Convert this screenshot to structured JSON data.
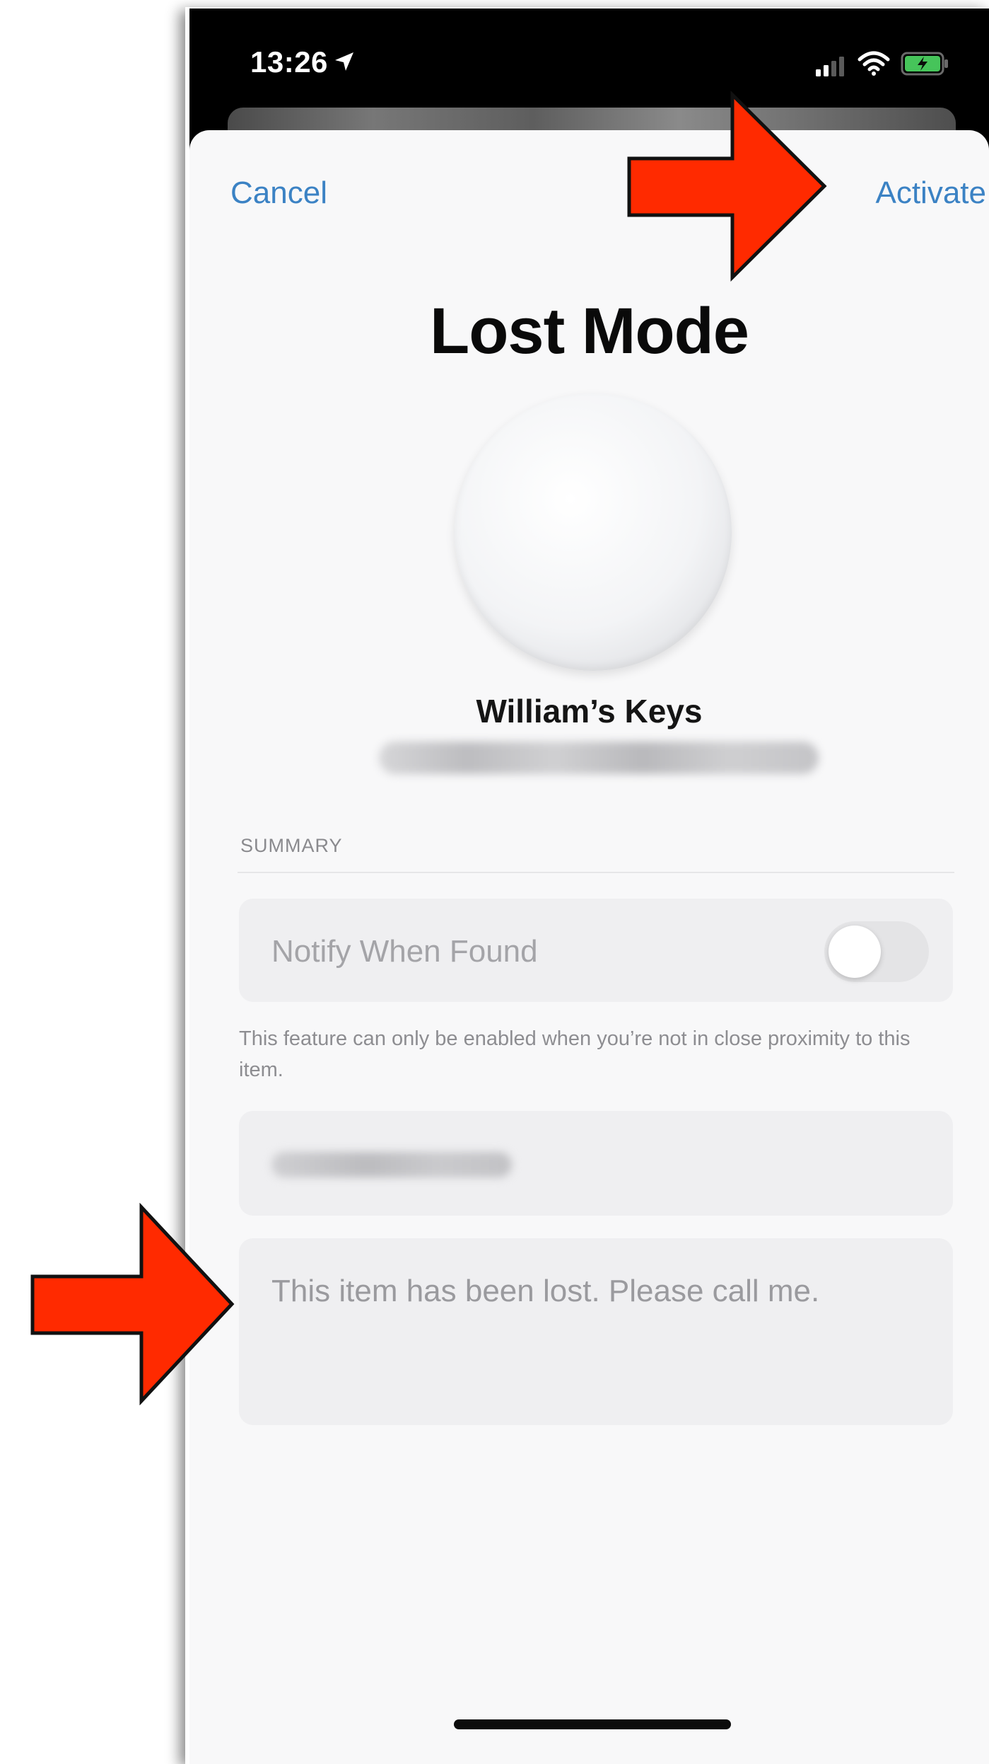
{
  "status_bar": {
    "time": "13:26",
    "icons": [
      "location-arrow-icon",
      "cellular-signal-icon",
      "wifi-icon",
      "battery-charging-icon"
    ]
  },
  "nav": {
    "cancel_label": "Cancel",
    "activate_label": "Activate"
  },
  "page": {
    "title": "Lost Mode"
  },
  "item": {
    "name": "William’s Keys"
  },
  "summary": {
    "header": "SUMMARY",
    "notify_label": "Notify When Found",
    "notify_enabled": false,
    "footnote": "This feature can only be enabled when you’re not in close proximity to this item."
  },
  "message": {
    "value": "This item has been lost. Please call me."
  },
  "colors": {
    "accent": "#3b82c4",
    "annotation_arrow": "#ff2a00",
    "sheet_background": "#f8f8f9",
    "field_background": "#efeff1"
  },
  "annotations": [
    "red-arrow-pointing-to-activate",
    "red-arrow-pointing-to-message-field"
  ]
}
